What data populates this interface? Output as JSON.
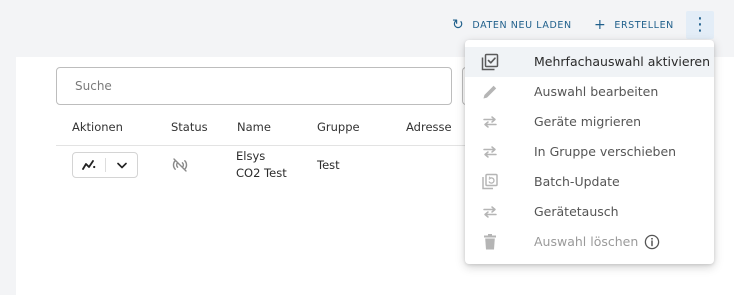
{
  "toolbar": {
    "reload_label": "DATEN NEU LADEN",
    "create_label": "ERSTELLEN",
    "more_glyph": "⋮"
  },
  "search": {
    "placeholder": "Suche"
  },
  "table": {
    "columns": [
      "Aktionen",
      "Status",
      "Name",
      "Gruppe",
      "Adresse"
    ],
    "rows": [
      {
        "name": "Elsys CO2 Test",
        "name_line1": "Elsys",
        "name_line2": "CO2 Test",
        "group": "Test",
        "status_icon": "sensor-offline-icon"
      }
    ]
  },
  "menu": {
    "items": [
      {
        "label": "Mehrfachauswahl aktivieren",
        "icon": "checklist-icon",
        "state": "active"
      },
      {
        "label": "Auswahl bearbeiten",
        "icon": "pencil-icon",
        "state": "enabled"
      },
      {
        "label": "Geräte migrieren",
        "icon": "swap-arrows-icon",
        "state": "enabled"
      },
      {
        "label": "In Gruppe verschieben",
        "icon": "swap-arrows-icon",
        "state": "enabled"
      },
      {
        "label": "Batch-Update",
        "icon": "copy-refresh-icon",
        "state": "enabled"
      },
      {
        "label": "Gerätetausch",
        "icon": "swap-arrows-icon",
        "state": "enabled"
      },
      {
        "label": "Auswahl löschen",
        "icon": "trash-icon",
        "state": "disabled",
        "has_info": true
      }
    ]
  },
  "colors": {
    "accent": "#1f5f8b",
    "menu_icon": "#b5b5b5",
    "menu_icon_active": "#5a5a5a",
    "highlight": "#f0f3f6"
  }
}
